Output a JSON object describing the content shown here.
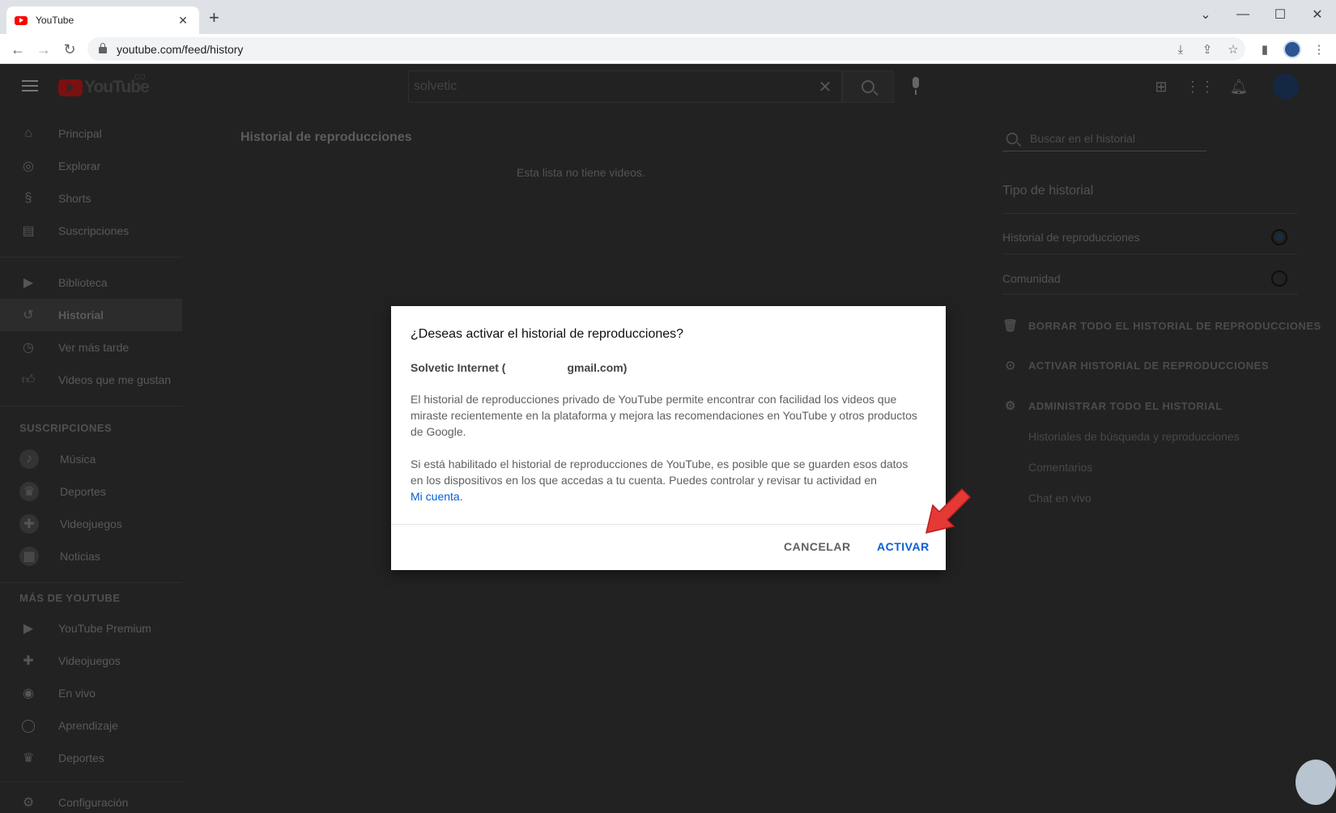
{
  "browser": {
    "tab_title": "YouTube",
    "tab_close": "✕",
    "new_tab": "+",
    "url": "youtube.com/feed/history",
    "window_controls": [
      "⌄",
      "—",
      "☐",
      "✕"
    ]
  },
  "yt_header": {
    "logo_text": "YouTube",
    "logo_country": "CO",
    "search_query": "solvetic"
  },
  "guide": {
    "main_items": [
      {
        "label": "Principal",
        "icon": "home-icon"
      },
      {
        "label": "Explorar",
        "icon": "compass-icon"
      },
      {
        "label": "Shorts",
        "icon": "shorts-icon"
      },
      {
        "label": "Suscripciones",
        "icon": "subscriptions-icon"
      }
    ],
    "library_items": [
      {
        "label": "Biblioteca",
        "icon": "library-icon"
      },
      {
        "label": "Historial",
        "icon": "history-icon"
      },
      {
        "label": "Ver más tarde",
        "icon": "clock-icon"
      },
      {
        "label": "Videos que me gustan",
        "icon": "thumbs-up-icon"
      }
    ],
    "subs_heading": "SUSCRIPCIONES",
    "subs_items": [
      {
        "label": "Música",
        "icon": "music-icon"
      },
      {
        "label": "Deportes",
        "icon": "trophy-icon"
      },
      {
        "label": "Videojuegos",
        "icon": "gamepad-icon"
      },
      {
        "label": "Noticias",
        "icon": "news-icon"
      }
    ],
    "more_heading": "MÁS DE YOUTUBE",
    "more_items": [
      {
        "label": "YouTube Premium",
        "icon": "youtube-premium-icon"
      },
      {
        "label": "Videojuegos",
        "icon": "gamepad-icon"
      },
      {
        "label": "En vivo",
        "icon": "live-icon"
      },
      {
        "label": "Aprendizaje",
        "icon": "lightbulb-icon"
      },
      {
        "label": "Deportes",
        "icon": "trophy-icon"
      }
    ],
    "settings": {
      "label": "Configuración",
      "icon": "gear-icon"
    }
  },
  "main": {
    "title": "Historial de reproducciones",
    "empty_message": "Esta lista no tiene videos."
  },
  "history_panel": {
    "search_placeholder": "Buscar en el historial",
    "type_heading": "Tipo de historial",
    "options": [
      {
        "label": "Historial de reproducciones",
        "selected": true
      },
      {
        "label": "Comunidad",
        "selected": false
      }
    ],
    "actions": [
      {
        "label": "BORRAR TODO EL HISTORIAL DE REPRODUCCIONES",
        "icon": "trash-icon"
      },
      {
        "label": "ACTIVAR HISTORIAL DE REPRODUCCIONES",
        "icon": "play-circle-icon"
      },
      {
        "label": "ADMINISTRAR TODO EL HISTORIAL",
        "icon": "gear-icon"
      }
    ],
    "sub_links": [
      "Historiales de búsqueda y reproducciones",
      "Comentarios",
      "Chat en vivo"
    ]
  },
  "dialog": {
    "title": "¿Deseas activar el historial de reproducciones?",
    "account_name": "Solvetic Internet (",
    "account_email_suffix": "gmail.com)",
    "paragraph1": "El historial de reproducciones privado de YouTube permite encontrar con facilidad los videos que miraste recientemente en la plataforma y mejora las recomendaciones en YouTube y otros productos de Google.",
    "paragraph2": "Si está habilitado el historial de reproducciones de YouTube, es posible que se guarden esos datos en los dispositivos en los que accedas a tu cuenta. Puedes controlar y revisar tu actividad en",
    "link_text": "Mi cuenta",
    "link_suffix": ".",
    "cancel_label": "CANCELAR",
    "activate_label": "ACTIVAR"
  },
  "colors": {
    "accent_blue": "#065fd4",
    "youtube_red": "#ff0000",
    "overlay_bg": "#222222",
    "annotation_arrow": "#e53935"
  }
}
